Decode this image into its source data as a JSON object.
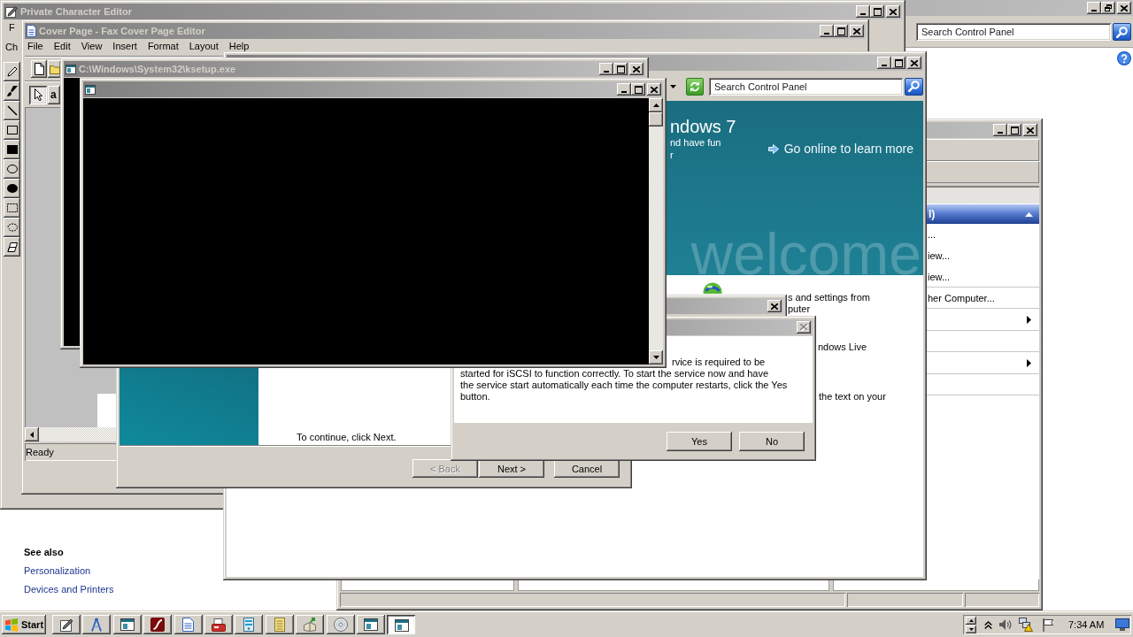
{
  "control_panel": {
    "search": {
      "placeholder": "Search Control Panel"
    },
    "see_also": {
      "heading": "See also",
      "links": [
        "Personalization",
        "Devices and Printers"
      ]
    }
  },
  "character_editor": {
    "title": "Private Character Editor",
    "menu": [
      "F"
    ],
    "toolbar_label": "Ch"
  },
  "fax_editor": {
    "title": "Cover Page - Fax Cover Page Editor",
    "menu": [
      "File",
      "Edit",
      "View",
      "Insert",
      "Format",
      "Layout",
      "Help"
    ],
    "tools": [
      {
        "kind": "select",
        "selected": true
      },
      {
        "kind": "text",
        "label": "a",
        "selected": false
      }
    ],
    "status": "Ready"
  },
  "explorer": {
    "pane": {
      "header": "l)",
      "expanded": true,
      "items": [
        {
          "kind": "link",
          "label": "..."
        },
        {
          "kind": "link",
          "label": "iew..."
        },
        {
          "kind": "link",
          "label": "iew..."
        },
        {
          "kind": "link",
          "label": "her Computer..."
        },
        {
          "kind": "submenu"
        },
        {
          "kind": "submenu"
        }
      ]
    }
  },
  "welcome_center": {
    "search": {
      "placeholder": "Search Control Panel"
    },
    "banner": {
      "heading": "ndows 7",
      "lines": [
        "nd have fun",
        "r"
      ],
      "link": "Go online to learn more",
      "backdrop_text": "welcome"
    },
    "task_texts": [
      "s and settings from",
      "puter",
      "ndows Live",
      "the text on your"
    ]
  },
  "setup_wizard": {
    "text": "To continue, click Next.",
    "buttons": [
      {
        "label": "< Back",
        "disabled": true
      },
      {
        "label": "Next >",
        "disabled": false
      },
      {
        "label": "Cancel",
        "disabled": false
      }
    ]
  },
  "ksetup_console": {
    "title": "C:\\Windows\\System32\\ksetup.exe"
  },
  "message_box": {
    "close_button": {
      "disabled": true
    },
    "text_parts": [
      "rvice is required to be",
      "started for iSCSI to function correctly. To start the service now and have\nthe service start automatically each time the computer restarts, click the Yes\nbutton."
    ],
    "buttons": [
      "Yes",
      "No"
    ]
  },
  "taskbar": {
    "start": "Start",
    "buttons": [
      {
        "selected": false
      },
      {
        "selected": false
      },
      {
        "selected": false
      },
      {
        "selected": false
      },
      {
        "selected": false
      },
      {
        "selected": false
      },
      {
        "selected": false
      },
      {
        "selected": false
      },
      {
        "selected": false
      },
      {
        "selected": false
      },
      {
        "selected": false
      },
      {
        "selected": true
      }
    ],
    "clock": "7:34 AM"
  }
}
